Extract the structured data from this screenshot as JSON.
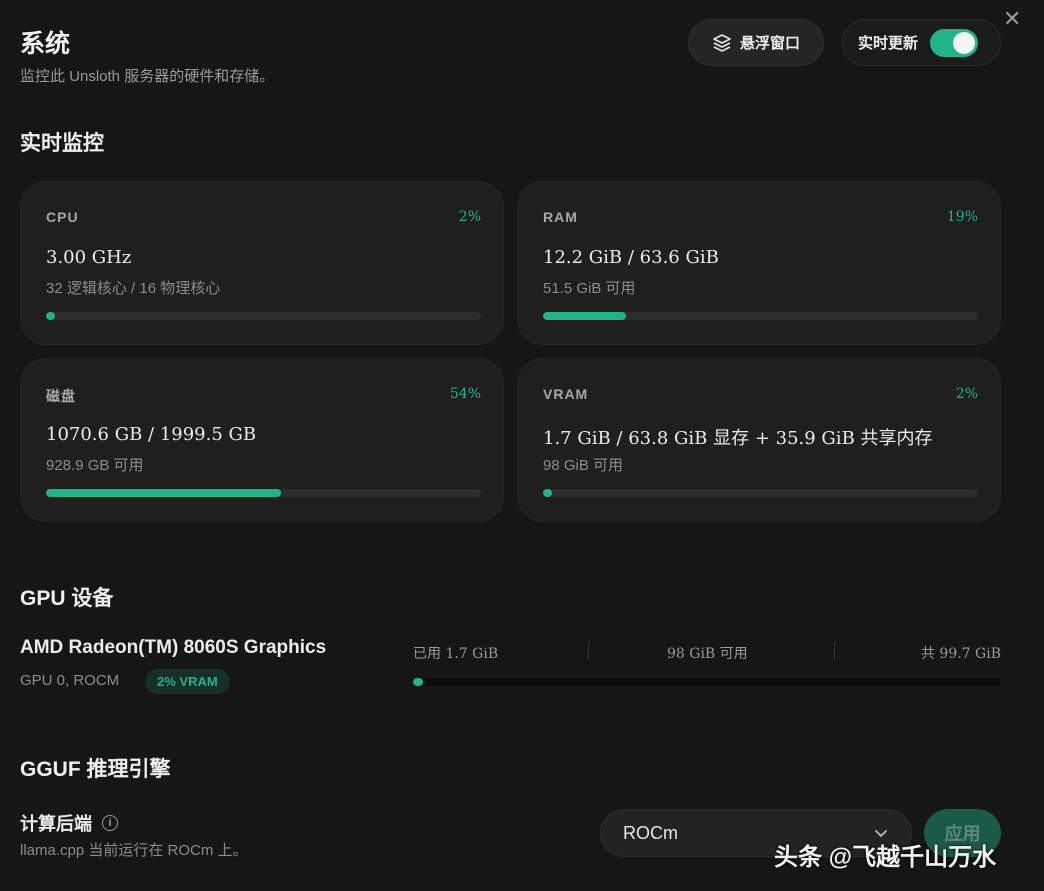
{
  "header": {
    "title": "系统",
    "subtitle": "监控此 Unsloth 服务器的硬件和存储。",
    "float_window_label": "悬浮窗口",
    "live_update_label": "实时更新",
    "live_update_on": true
  },
  "monitor": {
    "section_title": "实时监控",
    "cards": [
      {
        "label": "CPU",
        "percent": "2%",
        "fill": 0.02,
        "value": "3.00 GHz",
        "sub": "32 逻辑核心 / 16 物理核心"
      },
      {
        "label": "RAM",
        "percent": "19%",
        "fill": 0.19,
        "value": "12.2 GiB / 63.6 GiB",
        "sub": "51.5 GiB 可用"
      },
      {
        "label": "磁盘",
        "percent": "54%",
        "fill": 0.54,
        "value": "1070.6 GB / 1999.5 GB",
        "sub": "928.9 GB 可用"
      },
      {
        "label": "VRAM",
        "percent": "2%",
        "fill": 0.02,
        "value": "1.7 GiB / 63.8 GiB 显存 + 35.9 GiB 共享内存",
        "sub": "98 GiB 可用"
      }
    ]
  },
  "gpu": {
    "section_title": "GPU 设备",
    "name": "AMD Radeon(TM) 8060S Graphics",
    "meta": "GPU 0, ROCM",
    "badge": "2% VRAM",
    "used": "已用 1.7 GiB",
    "available": "98 GiB 可用",
    "total": "共 99.7 GiB",
    "fill": 0.017
  },
  "gguf": {
    "section_title": "GGUF 推理引擎",
    "backend_label": "计算后端",
    "backend_desc": "llama.cpp 当前运行在 ROCm 上。",
    "backend_value": "ROCm",
    "apply_label": "应用"
  },
  "watermark": "头条 @飞越千山万水",
  "colors": {
    "accent": "#23b38a",
    "background": "#161616",
    "card": "#1f1f1f"
  },
  "icons": {
    "float_window": "layers-icon",
    "close": "close-icon",
    "select": "chevron-down-icon",
    "info": "info-icon"
  }
}
